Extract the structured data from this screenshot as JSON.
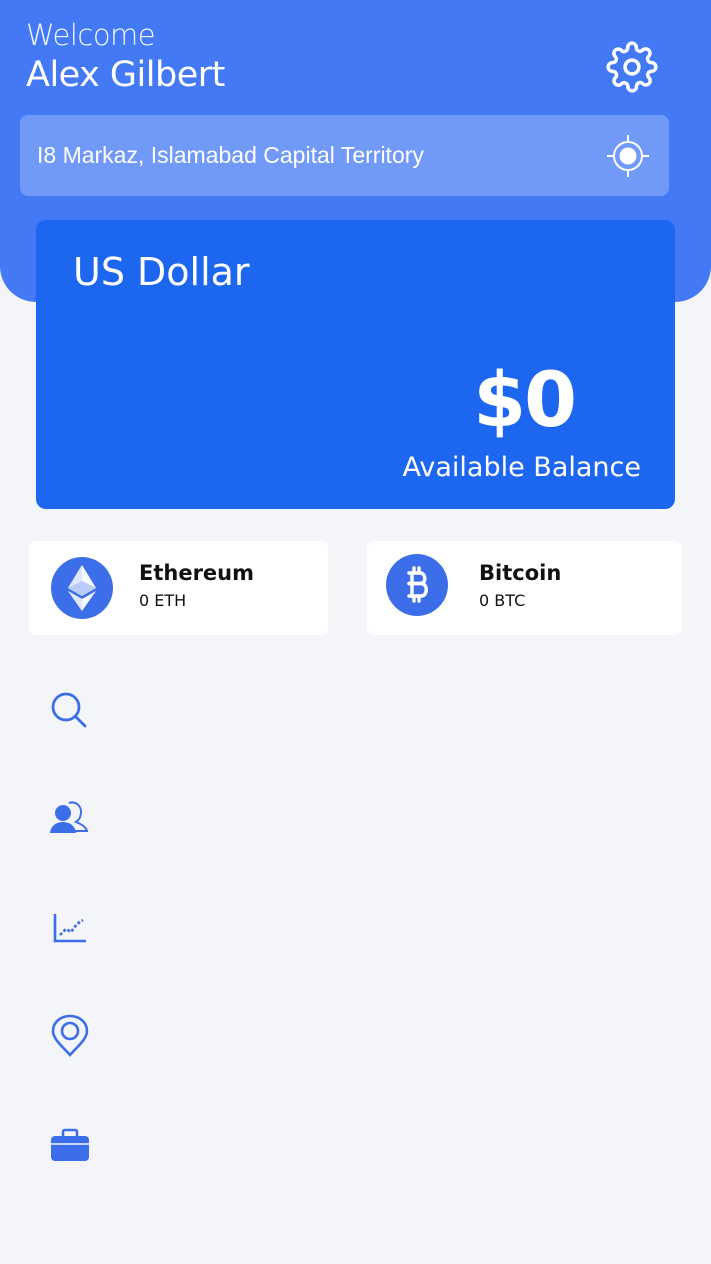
{
  "header": {
    "welcome": "Welcome",
    "user_name": "Alex Gilbert",
    "settings_icon": "gear-icon"
  },
  "location": {
    "address": "I8 Markaz, Islamabad Capital Territory",
    "icon": "crosshair-icon"
  },
  "balance_card": {
    "currency": "US Dollar",
    "amount": "$0",
    "label": "Available Balance"
  },
  "coins": [
    {
      "name": "Ethereum",
      "amount": "0 ETH",
      "icon": "ethereum-icon"
    },
    {
      "name": "Bitcoin",
      "amount": "0 BTC",
      "icon": "bitcoin-icon"
    }
  ],
  "nav": [
    {
      "icon": "search-icon"
    },
    {
      "icon": "users-icon"
    },
    {
      "icon": "chart-icon"
    },
    {
      "icon": "location-pin-icon"
    },
    {
      "icon": "briefcase-icon"
    }
  ],
  "colors": {
    "header_bg": "#4479f5",
    "location_bar_bg": "#7199f8",
    "card_bg": "#1d66f0",
    "icon_blue": "#3d6eea",
    "page_bg": "#f4f5f9"
  }
}
